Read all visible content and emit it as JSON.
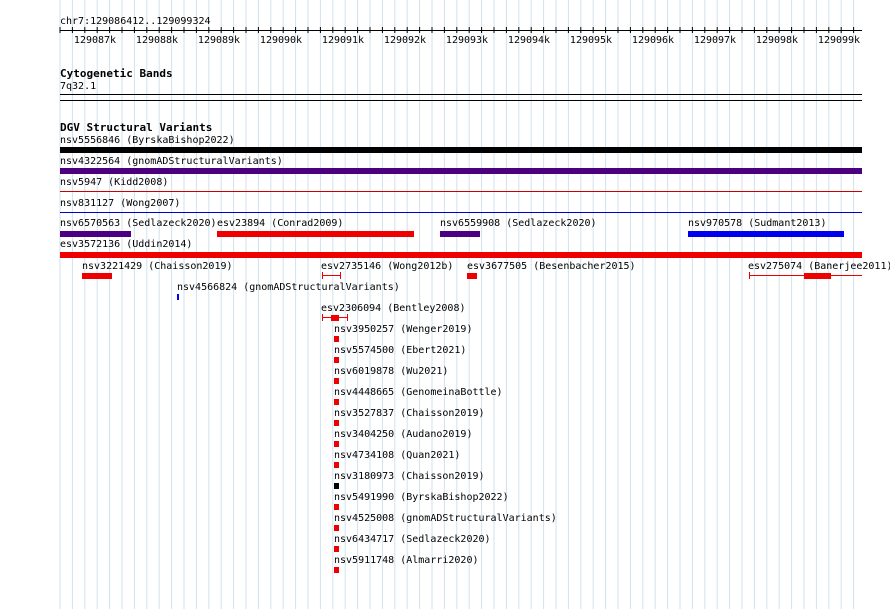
{
  "coord_label": "chr7:129086412..129099324",
  "ruler": {
    "ticks": [
      "129087k",
      "129088k",
      "129089k",
      "129090k",
      "129091k",
      "129092k",
      "129093k",
      "129094k",
      "129095k",
      "129096k",
      "129097k",
      "129098k",
      "129099k"
    ]
  },
  "cytoband": {
    "title": "Cytogenetic Bands",
    "band": "7q32.1"
  },
  "dgv": {
    "title": "DGV Structural Variants",
    "features": [
      {
        "label": "nsv5556846 (ByrskaBishop2022)",
        "color": "#000000"
      },
      {
        "label": "nsv4322564 (gnomADStructuralVariants)",
        "color": "#4b0082"
      },
      {
        "label": "nsv5947 (Kidd2008)",
        "color": "#cc0000"
      },
      {
        "label": "nsv831127 (Wong2007)",
        "color": "#0000cc"
      },
      {
        "label": "nsv6570563 (Sedlazeck2020)",
        "color": "#4b0082"
      },
      {
        "label": "esv23894 (Conrad2009)",
        "color": "#ee0000"
      },
      {
        "label": "nsv6559908 (Sedlazeck2020)",
        "color": "#4b0082"
      },
      {
        "label": "nsv970578 (Sudmant2013)",
        "color": "#0000ee"
      },
      {
        "label": "esv3572136 (Uddin2014)",
        "color": "#ee0000"
      },
      {
        "label": "nsv3221429 (Chaisson2019)",
        "color": "#ee0000"
      },
      {
        "label": "esv2735146 (Wong2012b)",
        "color": "#ee0000"
      },
      {
        "label": "esv3677505 (Besenbacher2015)",
        "color": "#ee0000"
      },
      {
        "label": "esv275074 (Banerjee2011)",
        "color": "#ee0000"
      },
      {
        "label": "nsv4566824 (gnomADStructuralVariants)",
        "color": "#0000ee"
      },
      {
        "label": "esv2306094 (Bentley2008)",
        "color": "#ee0000"
      },
      {
        "label": "nsv3950257 (Wenger2019)",
        "color": "#ee0000"
      },
      {
        "label": "nsv5574500 (Ebert2021)",
        "color": "#ee0000"
      },
      {
        "label": "nsv6019878 (Wu2021)",
        "color": "#ee0000"
      },
      {
        "label": "nsv4448665 (GenomeinaBottle)",
        "color": "#ee0000"
      },
      {
        "label": "nsv3527837 (Chaisson2019)",
        "color": "#ee0000"
      },
      {
        "label": "nsv3404250 (Audano2019)",
        "color": "#ee0000"
      },
      {
        "label": "nsv4734108 (Quan2021)",
        "color": "#ee0000"
      },
      {
        "label": "nsv3180973 (Chaisson2019)",
        "color": "#000000"
      },
      {
        "label": "nsv5491990 (ByrskaBishop2022)",
        "color": "#ee0000"
      },
      {
        "label": "nsv4525008 (gnomADStructuralVariants)",
        "color": "#ee0000"
      },
      {
        "label": "nsv6434717 (Sedlazeck2020)",
        "color": "#ee0000"
      },
      {
        "label": "nsv5911748 (Almarri2020)",
        "color": "#ee0000"
      }
    ]
  }
}
